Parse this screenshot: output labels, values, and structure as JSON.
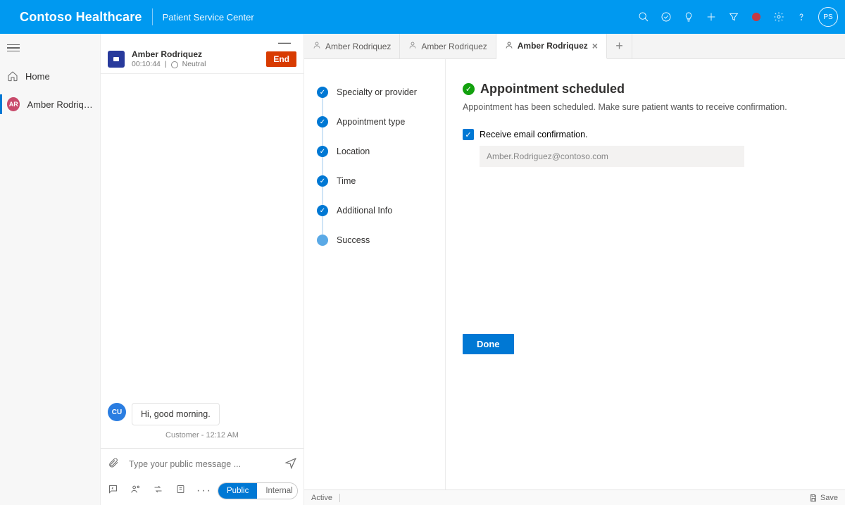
{
  "header": {
    "brand": "Contoso Healthcare",
    "app": "Patient Service Center",
    "avatar_initials": "PS"
  },
  "sidebar": {
    "home_label": "Home",
    "session_initials": "AR",
    "session_label": "Amber Rodriquez"
  },
  "chat": {
    "customer_name": "Amber Rodriquez",
    "timer": "00:10:44",
    "sentiment": "Neutral",
    "end_label": "End",
    "message_text": "Hi, good morning.",
    "message_from_initials": "CU",
    "message_meta": "Customer - 12:12 AM",
    "compose_placeholder": "Type your public message ...",
    "pill_public": "Public",
    "pill_internal": "Internal"
  },
  "tabs": {
    "t0": "Amber Rodriquez",
    "t1": "Amber Rodriquez",
    "t2": "Amber Rodriquez"
  },
  "steps": {
    "s0": "Specialty or provider",
    "s1": "Appointment type",
    "s2": "Location",
    "s3": "Time",
    "s4": "Additional Info",
    "s5": "Success"
  },
  "content": {
    "title": "Appointment scheduled",
    "subtitle": "Appointment has been scheduled. Make sure patient wants to receive confirmation.",
    "confirm_label": "Receive email confirmation.",
    "email_value": "Amber.Rodriguez@contoso.com",
    "done_label": "Done"
  },
  "footer": {
    "status": "Active",
    "save": "Save"
  }
}
